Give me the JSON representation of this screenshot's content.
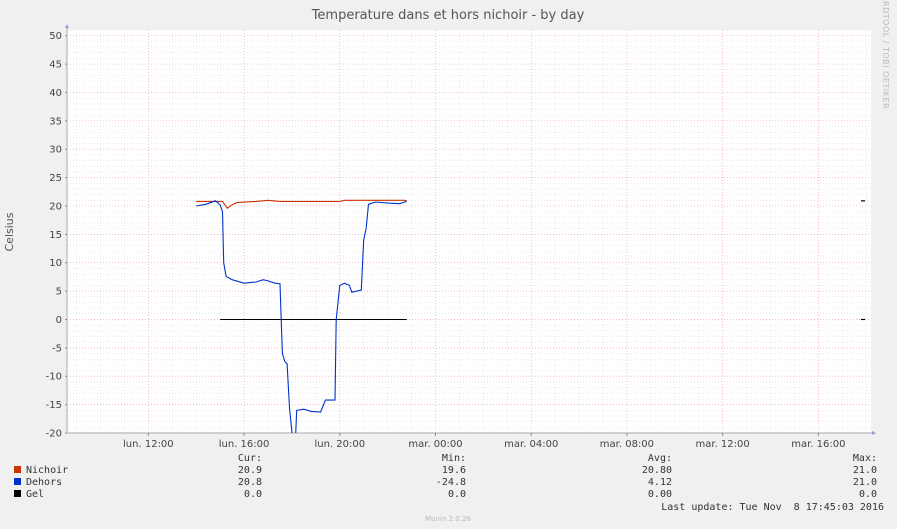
{
  "chart_data": {
    "type": "line",
    "title": "Temperature dans et hors nichoir - by day",
    "ylabel": "Celsius",
    "side_label": "RRDTOOL / TOBI OETIKER",
    "ylim": [
      -20,
      51
    ],
    "y_ticks": [
      50,
      45,
      40,
      35,
      30,
      25,
      20,
      15,
      10,
      5,
      0,
      -5,
      -10,
      -15,
      -20
    ],
    "x_range_hours": [
      8.6,
      42.2
    ],
    "x_ticks": [
      {
        "hour": 12,
        "label": "lun. 12:00"
      },
      {
        "hour": 16,
        "label": "lun. 16:00"
      },
      {
        "hour": 20,
        "label": "lun. 20:00"
      },
      {
        "hour": 24,
        "label": "mar. 00:00"
      },
      {
        "hour": 28,
        "label": "mar. 04:00"
      },
      {
        "hour": 32,
        "label": "mar. 08:00"
      },
      {
        "hour": 36,
        "label": "mar. 12:00"
      },
      {
        "hour": 40,
        "label": "mar. 16:00"
      }
    ],
    "grid": true,
    "series": [
      {
        "name": "Nichoir",
        "color": "#cc3300",
        "points": [
          [
            14.0,
            20.8
          ],
          [
            15.1,
            20.8
          ],
          [
            15.2,
            20.2
          ],
          [
            15.3,
            19.6
          ],
          [
            15.5,
            20.2
          ],
          [
            15.7,
            20.6
          ],
          [
            16.5,
            20.8
          ],
          [
            17.0,
            21.0
          ],
          [
            17.5,
            20.8
          ],
          [
            20.0,
            20.8
          ],
          [
            20.2,
            21.0
          ],
          [
            22.7,
            21.0
          ],
          [
            22.8,
            20.9
          ]
        ]
      },
      {
        "name": "Dehors",
        "color": "#0033cc",
        "points": [
          [
            14.0,
            20.0
          ],
          [
            14.4,
            20.3
          ],
          [
            14.8,
            20.9
          ],
          [
            15.0,
            20.2
          ],
          [
            15.1,
            19.0
          ],
          [
            15.15,
            10.0
          ],
          [
            15.25,
            7.6
          ],
          [
            15.5,
            7.0
          ],
          [
            16.0,
            6.4
          ],
          [
            16.5,
            6.6
          ],
          [
            16.8,
            7.0
          ],
          [
            17.0,
            6.8
          ],
          [
            17.3,
            6.4
          ],
          [
            17.5,
            6.3
          ],
          [
            17.55,
            0.0
          ],
          [
            17.6,
            -6.0
          ],
          [
            17.7,
            -7.4
          ],
          [
            17.8,
            -7.8
          ],
          [
            17.9,
            -15.6
          ],
          [
            18.0,
            -19.8
          ],
          [
            18.05,
            -24.8
          ],
          [
            18.15,
            -21.0
          ],
          [
            18.2,
            -16.0
          ],
          [
            18.5,
            -15.8
          ],
          [
            18.8,
            -16.2
          ],
          [
            19.2,
            -16.3
          ],
          [
            19.4,
            -14.2
          ],
          [
            19.8,
            -14.2
          ],
          [
            19.85,
            0.0
          ],
          [
            19.9,
            2.0
          ],
          [
            20.0,
            6.0
          ],
          [
            20.2,
            6.4
          ],
          [
            20.4,
            6.0
          ],
          [
            20.5,
            4.8
          ],
          [
            20.9,
            5.2
          ],
          [
            21.0,
            14.0
          ],
          [
            21.1,
            16.0
          ],
          [
            21.2,
            20.3
          ],
          [
            21.5,
            20.7
          ],
          [
            22.0,
            20.5
          ],
          [
            22.5,
            20.4
          ],
          [
            22.8,
            20.8
          ]
        ]
      },
      {
        "name": "Gel",
        "color": "#000000",
        "points": [
          [
            15.0,
            0.0
          ],
          [
            22.8,
            0.0
          ]
        ]
      }
    ]
  },
  "legend": {
    "headers": {
      "cur": "Cur:",
      "min": "Min:",
      "avg": "Avg:",
      "max": "Max:"
    },
    "rows": [
      {
        "name": "Nichoir",
        "color": "#cc3300",
        "cur": "20.9",
        "min": "19.6",
        "avg": "20.80",
        "max": "21.0"
      },
      {
        "name": "Dehors",
        "color": "#0033cc",
        "cur": "20.8",
        "min": "-24.8",
        "avg": "4.12",
        "max": "21.0"
      },
      {
        "name": "Gel",
        "color": "#000000",
        "cur": "0.0",
        "min": "0.0",
        "avg": "0.00",
        "max": "0.0"
      }
    ]
  },
  "last_update": "Last update: Tue Nov  8 17:45:03 2016",
  "footer": "Munin 2.0.26"
}
